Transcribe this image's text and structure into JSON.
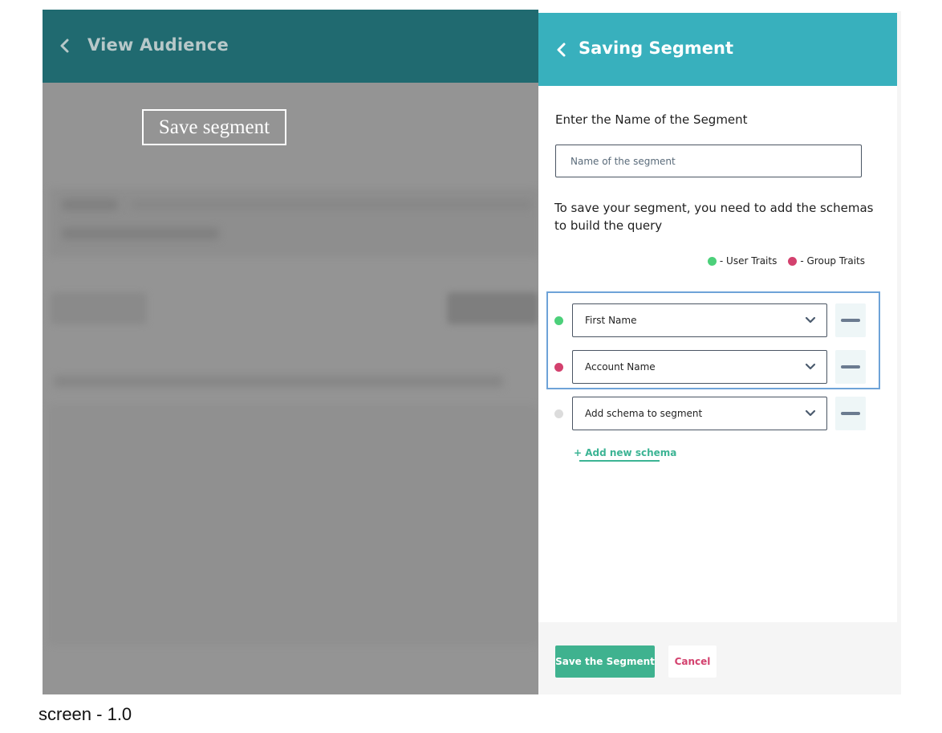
{
  "left": {
    "header_title": "View Audience",
    "back_icon": "chevron-left-icon",
    "save_segment_label": "Save segment"
  },
  "panel": {
    "header_title": "Saving Segment",
    "back_icon": "chevron-left-icon",
    "name_label": "Enter the Name of the Segment",
    "name_placeholder": "Name of the segment",
    "name_value": "",
    "info_text": "To save your segment, you need to add the schemas to build the query",
    "legend": [
      {
        "label": "- User Traits",
        "color": "#4cd07a"
      },
      {
        "label": "- Group Traits",
        "color": "#d3416e"
      }
    ],
    "schemas": [
      {
        "value": "First Name",
        "dot_color": "#4cd07a"
      },
      {
        "value": "Account Name",
        "dot_color": "#d3416e"
      },
      {
        "value": "Add schema to segment",
        "dot_color": "#dcdcdc"
      }
    ],
    "add_schema_label": "+ Add new schema",
    "save_button": "Save the Segment",
    "cancel_button": "Cancel"
  },
  "caption": "screen - 1.0",
  "colors": {
    "left_header": "#206a70",
    "panel_header": "#38b0bd",
    "save_button": "#3fb28f",
    "cancel_text": "#d3416e",
    "highlight": "#6ea3d8"
  }
}
